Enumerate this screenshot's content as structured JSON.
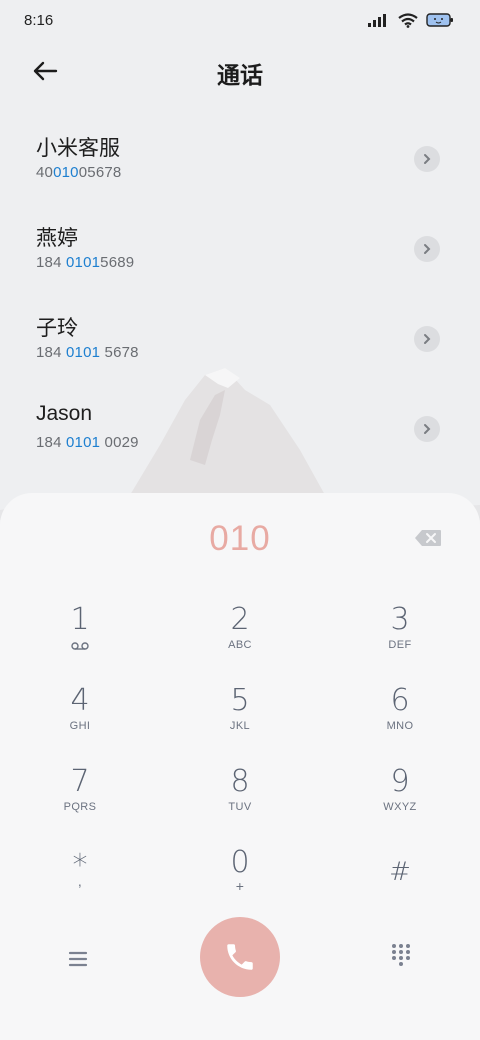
{
  "status": {
    "time": "8:16"
  },
  "header": {
    "title": "通话"
  },
  "contacts": [
    {
      "name": "小米客服",
      "num_pre": "40",
      "num_hl": "010",
      "num_post": "05678"
    },
    {
      "name": "燕婷",
      "num_pre": "184 ",
      "num_hl": "0101",
      "num_post": "5689"
    },
    {
      "name": "子玲",
      "num_pre": "184 ",
      "num_hl": "0101",
      "num_post": " 5678"
    },
    {
      "name": "Jason",
      "num_pre": "184 ",
      "num_hl": "0101",
      "num_post": " 0029"
    }
  ],
  "dialer": {
    "input": "010",
    "keys": [
      {
        "digit": "1",
        "letters": ""
      },
      {
        "digit": "2",
        "letters": "ABC"
      },
      {
        "digit": "3",
        "letters": "DEF"
      },
      {
        "digit": "4",
        "letters": "GHI"
      },
      {
        "digit": "5",
        "letters": "JKL"
      },
      {
        "digit": "6",
        "letters": "MNO"
      },
      {
        "digit": "7",
        "letters": "PQRS"
      },
      {
        "digit": "8",
        "letters": "TUV"
      },
      {
        "digit": "9",
        "letters": "WXYZ"
      },
      {
        "digit": "*",
        "letters": ","
      },
      {
        "digit": "0",
        "letters": "+"
      },
      {
        "digit": "#",
        "letters": ""
      }
    ]
  },
  "colors": {
    "accent_blue": "#1d7fd0",
    "call_button": "#e8b2ad",
    "dialed_text": "#e8aaa3"
  },
  "icons": {
    "back": "arrow-left-icon",
    "detail": "chevron-right-icon",
    "backspace": "backspace-icon",
    "voicemail": "voicemail-icon",
    "menu": "menu-icon",
    "call": "phone-icon",
    "keypad": "dialpad-icon"
  }
}
